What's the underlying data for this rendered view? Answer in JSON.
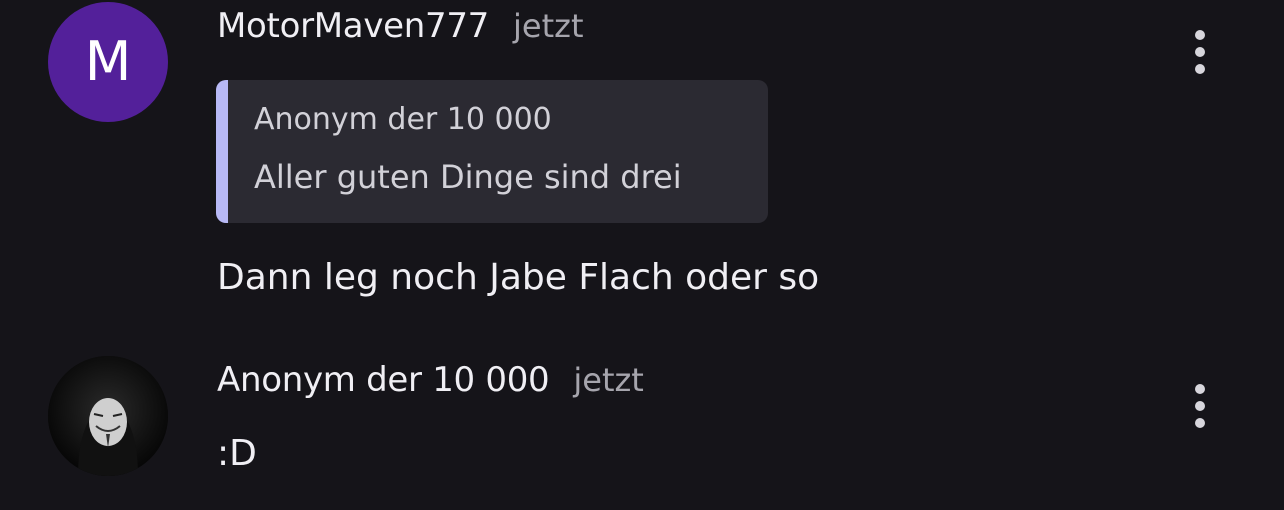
{
  "comments": [
    {
      "author": "MotorMaven777",
      "avatar_letter": "M",
      "avatar_color": "#53209a",
      "time": "jetzt",
      "quote": {
        "author": "Anonym der 10 000",
        "text": "Aller guten Dinge sind drei",
        "bar_color": "#b8b9f6"
      },
      "text": "Dann leg noch Jabe Flach oder so",
      "menu_icon": "more-vertical-icon"
    },
    {
      "author": "Anonym der 10 000",
      "avatar_icon": "anonymous-mask-avatar",
      "time": "jetzt",
      "text": ":D",
      "menu_icon": "more-vertical-icon"
    }
  ]
}
